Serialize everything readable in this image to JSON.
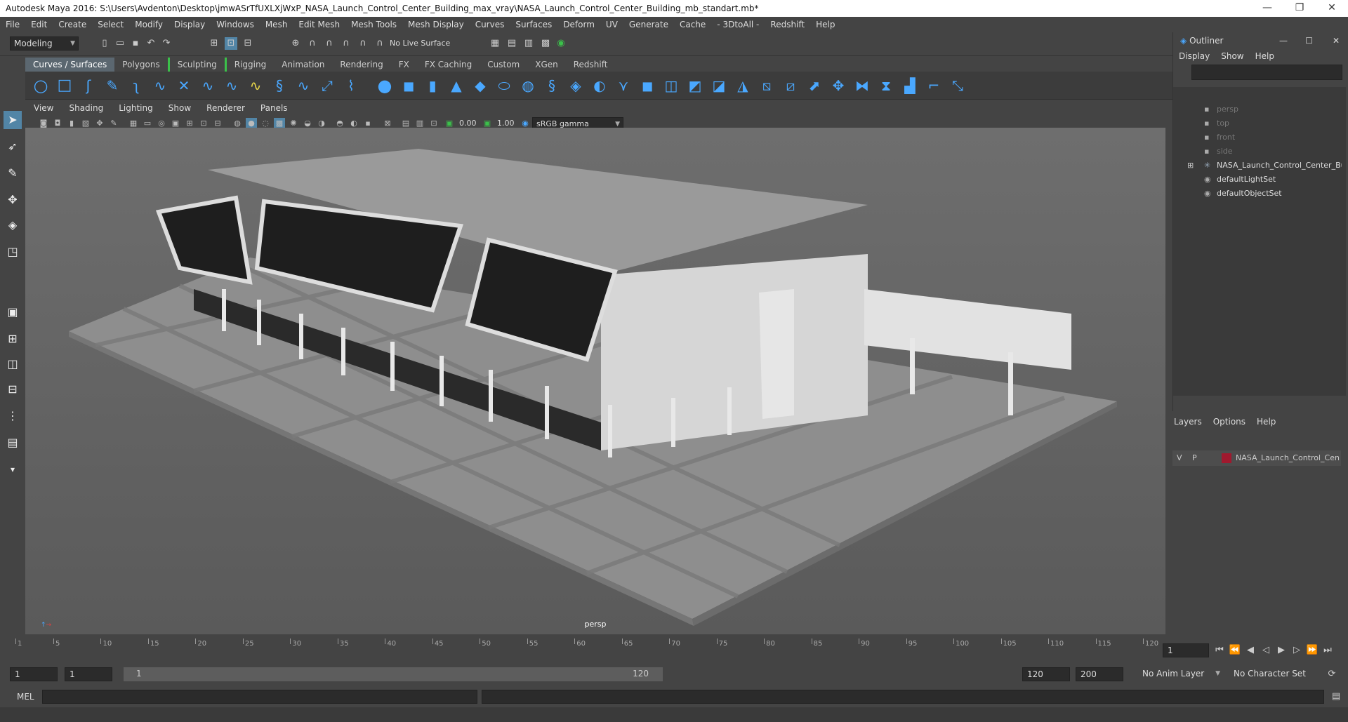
{
  "window": {
    "title": "Autodesk Maya 2016: S:\\Users\\Avdenton\\Desktop\\jmwASrTfUXLXjWxP_NASA_Launch_Control_Center_Building_max_vray\\NASA_Launch_Control_Center_Building_mb_standart.mb*",
    "min": "—",
    "max": "❐",
    "close": "✕"
  },
  "menubar": [
    "File",
    "Edit",
    "Create",
    "Select",
    "Modify",
    "Display",
    "Windows",
    "Mesh",
    "Edit Mesh",
    "Mesh Tools",
    "Mesh Display",
    "Curves",
    "Surfaces",
    "Deform",
    "UV",
    "Generate",
    "Cache",
    "- 3DtoAll -",
    "Redshift",
    "Help"
  ],
  "statusline": {
    "mode": "Modeling",
    "live_surface": "No Live Surface"
  },
  "shelf_tabs": [
    "Curves / Surfaces",
    "Polygons",
    "Sculpting",
    "Rigging",
    "Animation",
    "Rendering",
    "FX",
    "FX Caching",
    "Custom",
    "XGen",
    "Redshift"
  ],
  "panel_menu": [
    "View",
    "Shading",
    "Lighting",
    "Show",
    "Renderer",
    "Panels"
  ],
  "panel_tools": {
    "exposure": "0.00",
    "gamma": "1.00",
    "color_space": "sRGB gamma"
  },
  "viewport": {
    "camera": "persp"
  },
  "outliner": {
    "title": "Outliner",
    "menu": [
      "Display",
      "Show",
      "Help"
    ],
    "items": [
      {
        "label": "persp",
        "dim": true
      },
      {
        "label": "top",
        "dim": true
      },
      {
        "label": "front",
        "dim": true
      },
      {
        "label": "side",
        "dim": true
      },
      {
        "label": "NASA_Launch_Control_Center_Bu",
        "dim": false
      },
      {
        "label": "defaultLightSet",
        "dim": false
      },
      {
        "label": "defaultObjectSet",
        "dim": false
      }
    ]
  },
  "layers": {
    "menu": [
      "Layers",
      "Options",
      "Help"
    ],
    "row": {
      "v": "V",
      "p": "P",
      "name": "NASA_Launch_Control_Cen",
      "color": "#a0192e"
    }
  },
  "timeline": {
    "ticks": [
      "1",
      "5",
      "10",
      "15",
      "20",
      "25",
      "30",
      "35",
      "40",
      "45",
      "50",
      "55",
      "60",
      "65",
      "70",
      "75",
      "80",
      "85",
      "90",
      "95",
      "100",
      "105",
      "110",
      "115",
      "120"
    ],
    "current_frame": "1"
  },
  "range": {
    "start": "1",
    "start2": "1",
    "inner_start": "1",
    "inner_end": "120",
    "end": "120",
    "end2": "200",
    "anim_layer": "No Anim Layer",
    "char_set": "No Character Set"
  },
  "cmdline": {
    "lang": "MEL"
  }
}
